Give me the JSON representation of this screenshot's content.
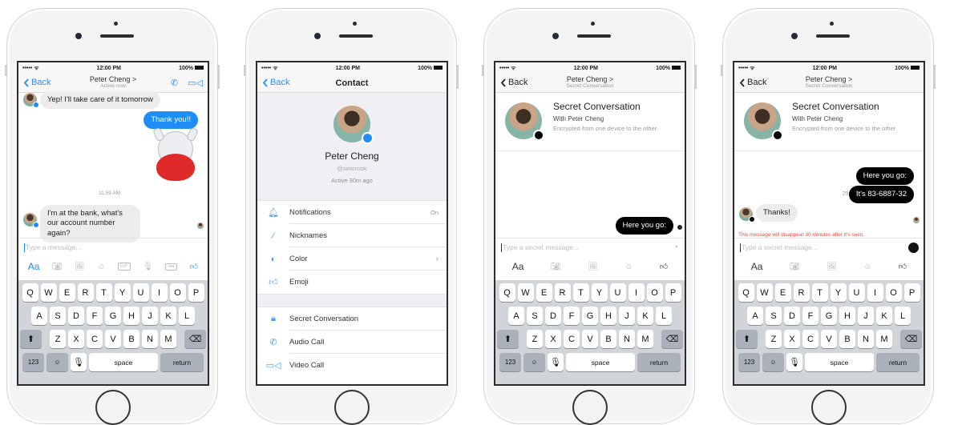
{
  "status": {
    "signal": "••••• ᯤ",
    "time": "12:00 PM",
    "battery": "100%"
  },
  "phone1": {
    "nav": {
      "back": "Back",
      "title": "Peter Cheng >",
      "subtitle": "Active now"
    },
    "messages": [
      {
        "from": "in",
        "text": "Yep! I'll take care of it tomorrow"
      },
      {
        "from": "out",
        "text": "Thank you!!"
      },
      {
        "from": "out",
        "type": "sticker",
        "text": "cat-heart-sticker"
      },
      {
        "from": "in",
        "text": "I'm at the bank, what's our account number again?"
      }
    ],
    "timestamp": "11:59 AM",
    "input_placeholder": "Type a message...",
    "toolbar": {
      "aa": "Aa",
      "gif": "GIF"
    }
  },
  "phone2": {
    "nav": {
      "back": "Back",
      "title": "Contact"
    },
    "contact": {
      "name": "Peter Cheng",
      "username": "@simonsok",
      "active": "Active 30m ago"
    },
    "section1": [
      {
        "label": "Notifications",
        "value": "On",
        "icon": "bell-icon"
      },
      {
        "label": "Nicknames",
        "icon": "pencil-icon"
      },
      {
        "label": "Color",
        "icon": "palette-icon",
        "chevron": true
      },
      {
        "label": "Emoji",
        "icon": "thumbs-up-icon"
      }
    ],
    "section2": [
      {
        "label": "Secret Conversation",
        "icon": "lock-icon"
      },
      {
        "label": "Audio Call",
        "icon": "phone-icon"
      },
      {
        "label": "Video Call",
        "icon": "video-icon"
      }
    ]
  },
  "phone3": {
    "nav": {
      "back": "Back",
      "title": "Peter Cheng >",
      "subtitle": "Secret Conversation"
    },
    "header": {
      "title": "Secret Conversation",
      "with": "With Peter Cheng",
      "desc": "Encrypted from one device to the other"
    },
    "messages": [
      {
        "from": "out",
        "text": "Here you go:"
      }
    ],
    "input_placeholder": "Type a secret message...",
    "toolbar": {
      "aa": "Aa"
    }
  },
  "phone4": {
    "nav": {
      "back": "Back",
      "title": "Peter Cheng >",
      "subtitle": "Secret Conversation"
    },
    "header": {
      "title": "Secret Conversation",
      "with": "With Peter Cheng",
      "desc": "Encrypted from one device to the other"
    },
    "messages": [
      {
        "from": "out",
        "text": "Here you go:"
      },
      {
        "from": "out",
        "text": "It's 83-6887-32"
      },
      {
        "from": "in",
        "text": "Thanks!"
      }
    ],
    "timer": "29:32",
    "warning": "This message will disappear 30 minutes after it's seen.",
    "input_placeholder": "Type a secret message...",
    "toolbar": {
      "aa": "Aa"
    }
  },
  "keyboard": {
    "row1": [
      "Q",
      "W",
      "E",
      "R",
      "T",
      "Y",
      "U",
      "I",
      "O",
      "P"
    ],
    "row2": [
      "A",
      "S",
      "D",
      "F",
      "G",
      "H",
      "J",
      "K",
      "L"
    ],
    "row3": [
      "Z",
      "X",
      "C",
      "V",
      "B",
      "N",
      "M"
    ],
    "num": "123",
    "space": "space",
    "return": "return"
  }
}
